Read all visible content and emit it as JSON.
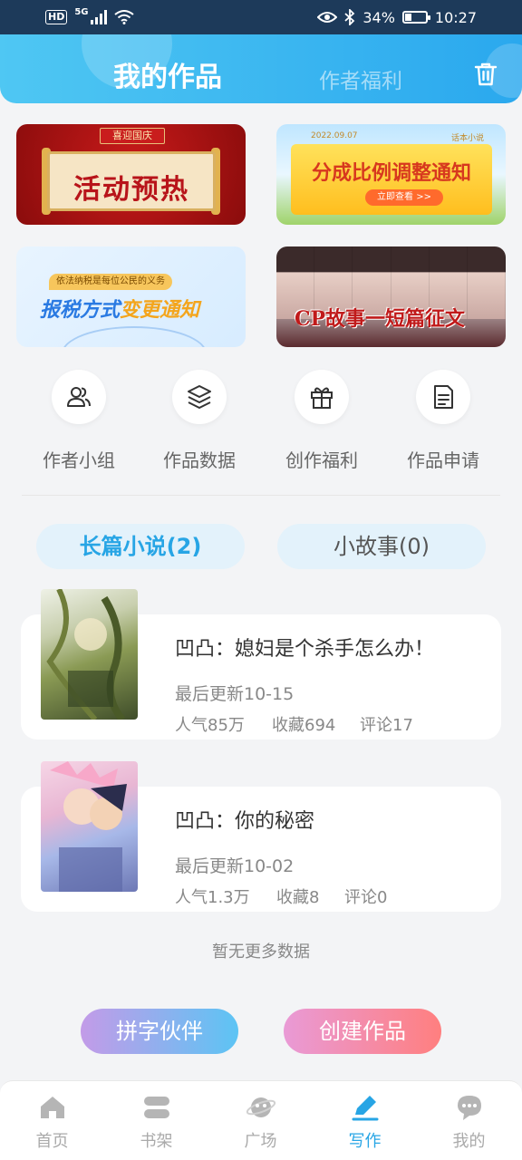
{
  "status_bar": {
    "hd": "HD",
    "network": "5G",
    "battery_percent": "34%",
    "battery_level": 0.34,
    "time": "10:27"
  },
  "header": {
    "tabs": [
      {
        "label": "我的作品",
        "active": true
      },
      {
        "label": "作者福利",
        "active": false
      }
    ],
    "trash_icon": "trash-icon"
  },
  "banners": [
    {
      "tag": "喜迎国庆",
      "title": "活动预热"
    },
    {
      "date": "2022.09.07",
      "brand": "话本小说",
      "title": "分成比例调整通知",
      "cta": "立即查看 >>"
    },
    {
      "tag": "依法纳税是每位公民的义务",
      "title_main": "报税方式",
      "title_accent": "变更通知"
    },
    {
      "title": "CP故事一短篇征文"
    }
  ],
  "quick_menu": [
    {
      "label": "作者小组",
      "icon": "users-icon"
    },
    {
      "label": "作品数据",
      "icon": "layers-icon"
    },
    {
      "label": "创作福利",
      "icon": "gift-icon"
    },
    {
      "label": "作品申请",
      "icon": "document-icon"
    }
  ],
  "type_tabs": [
    {
      "label": "长篇小说(2)",
      "active": true
    },
    {
      "label": "小故事(0)",
      "active": false
    }
  ],
  "works": [
    {
      "title": "凹凸：媳妇是个杀手怎么办！",
      "updated": "最后更新10-15",
      "popularity": "人气85万",
      "favorites": "收藏694",
      "comments": "评论17"
    },
    {
      "title": "凹凸：你的秘密",
      "updated": "最后更新10-02",
      "popularity": "人气1.3万",
      "favorites": "收藏8",
      "comments": "评论0"
    }
  ],
  "no_more": "暂无更多数据",
  "actions": {
    "partner": "拼字伙伴",
    "create": "创建作品"
  },
  "bottom_nav": [
    {
      "label": "首页",
      "icon": "home-icon",
      "active": false
    },
    {
      "label": "书架",
      "icon": "bookshelf-icon",
      "active": false
    },
    {
      "label": "广场",
      "icon": "planet-icon",
      "active": false
    },
    {
      "label": "写作",
      "icon": "pen-icon",
      "active": true
    },
    {
      "label": "我的",
      "icon": "chat-bubble-icon",
      "active": false
    }
  ],
  "colors": {
    "accent": "#27a5e5",
    "header_start": "#4fc7f3",
    "header_end": "#2aa8ee"
  }
}
